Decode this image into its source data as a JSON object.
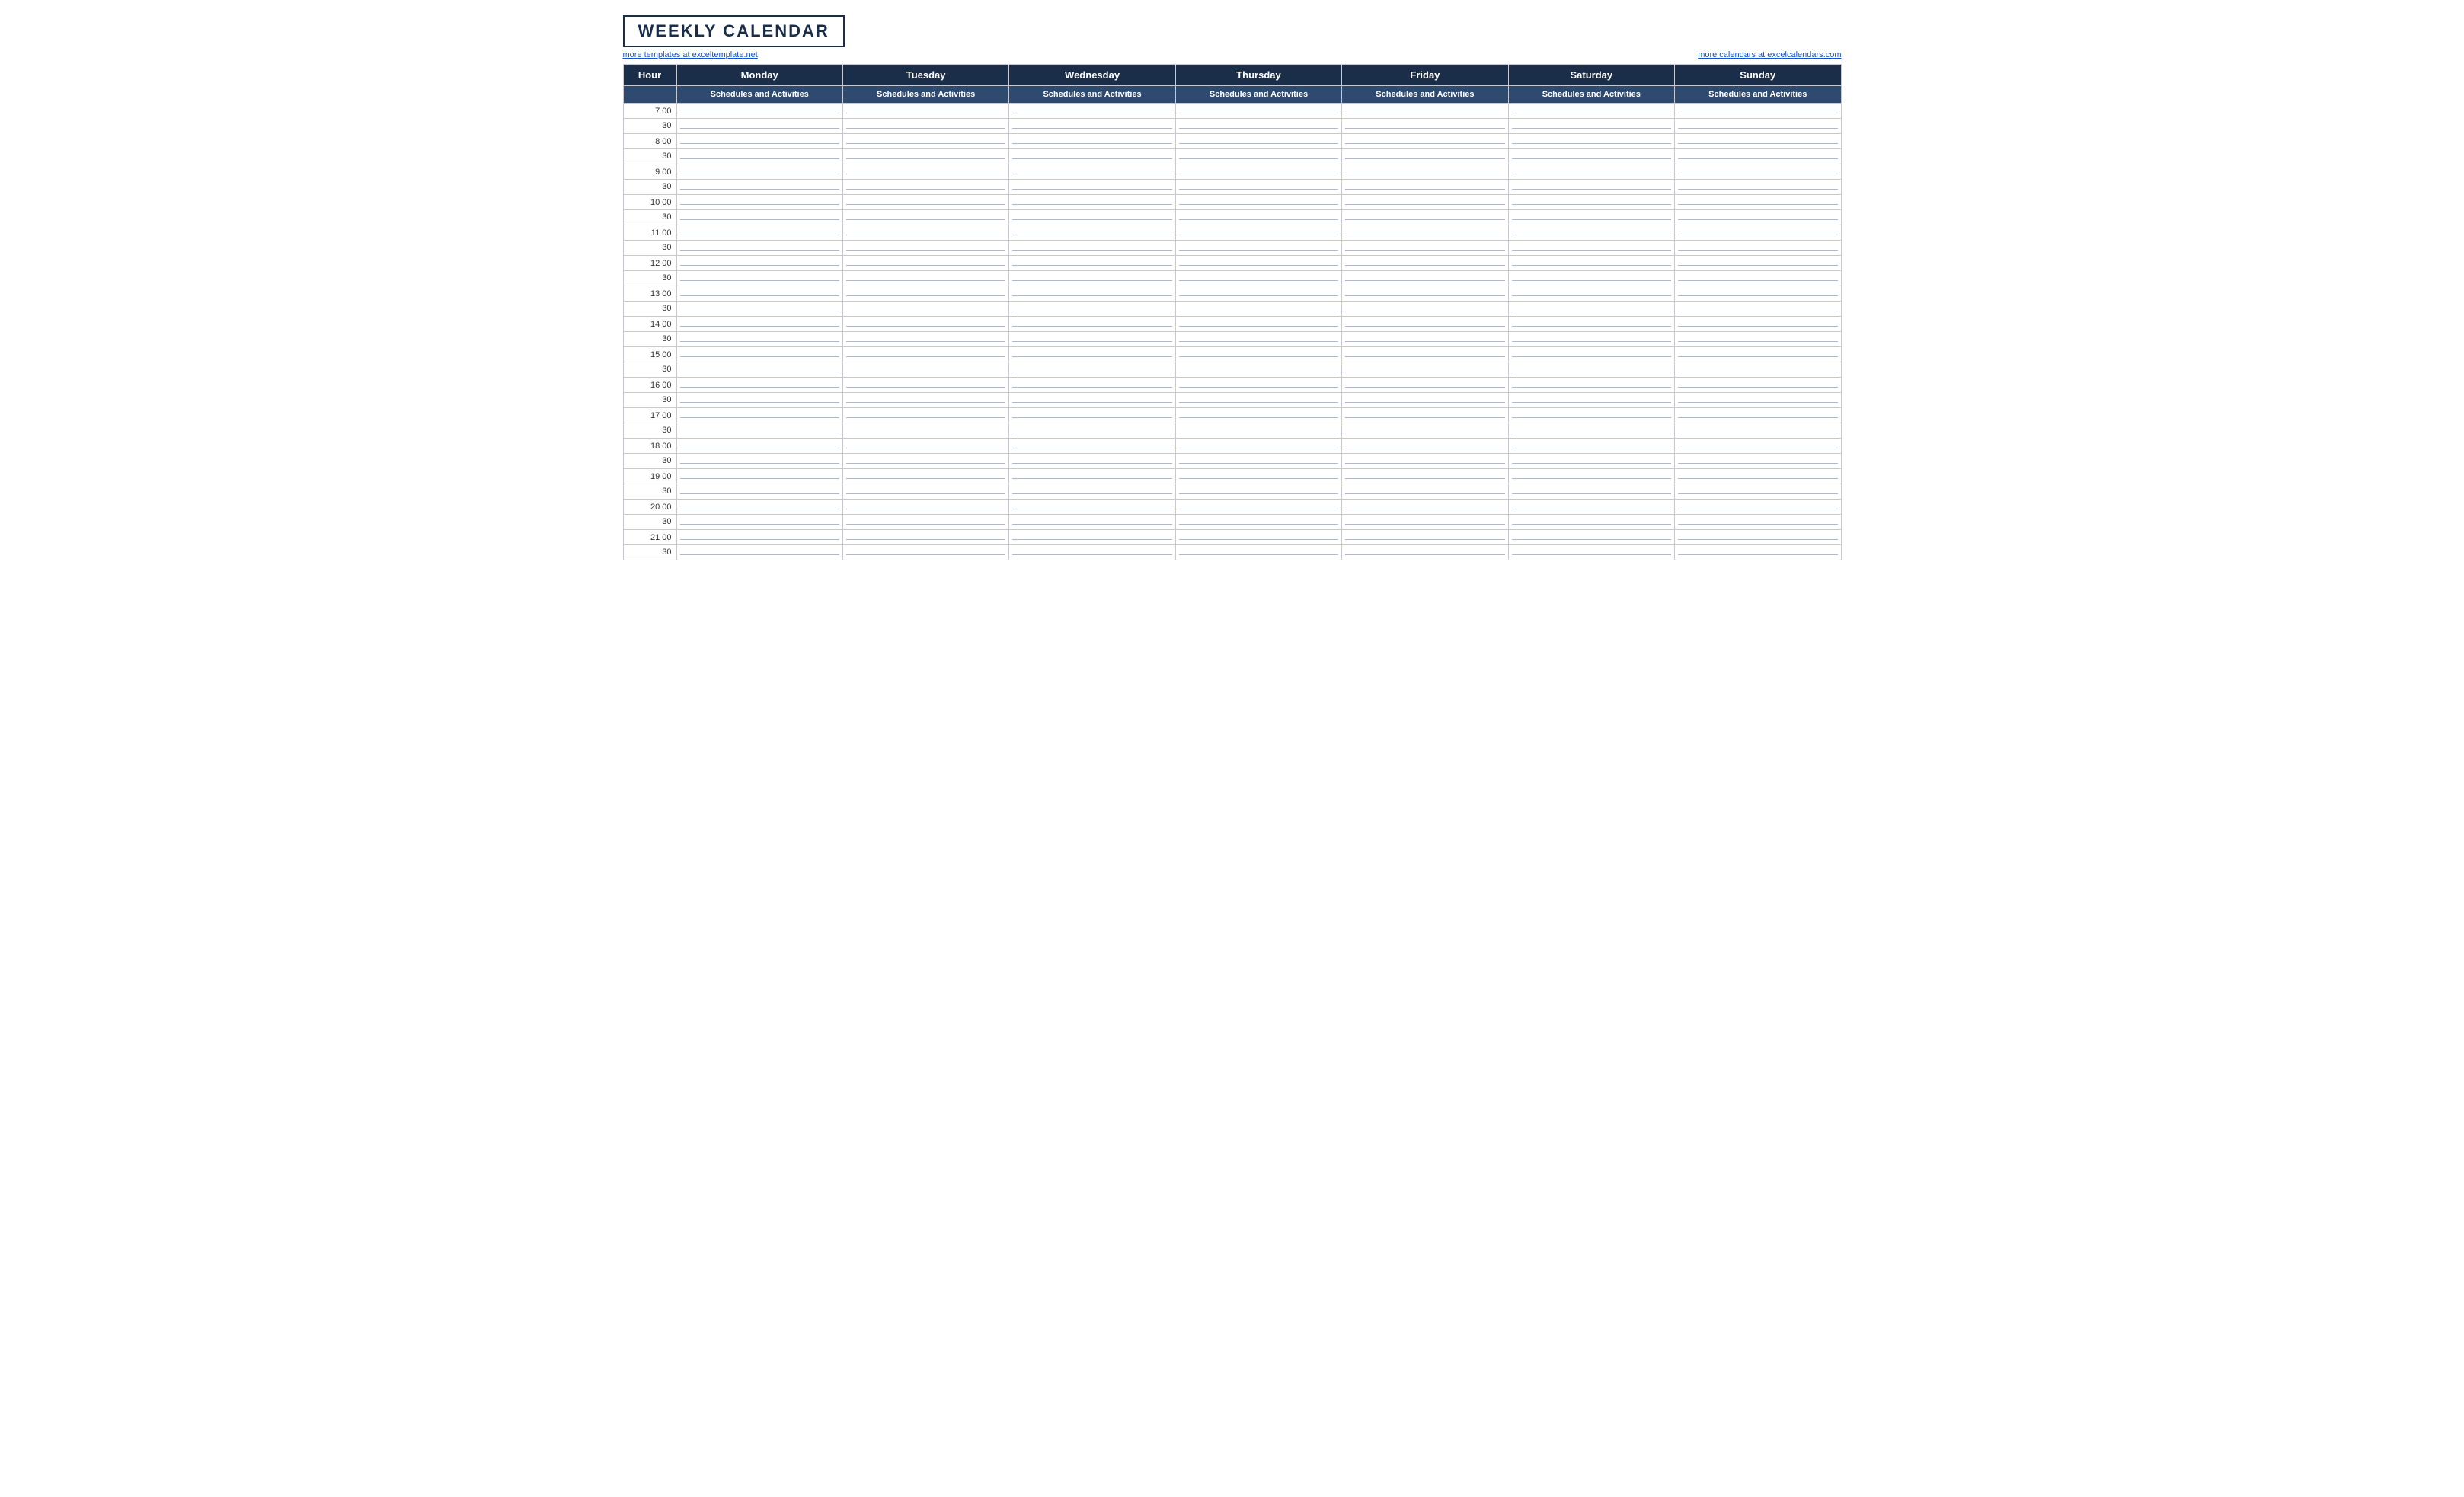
{
  "title": "WEEKLY CALENDAR",
  "link_left": "more templates at exceltemplate.net",
  "link_left_url": "#",
  "link_right": "more calendars at excelcalendars.com",
  "link_right_url": "#",
  "header": {
    "hour_label": "Hour",
    "days": [
      "Monday",
      "Tuesday",
      "Wednesday",
      "Thursday",
      "Friday",
      "Saturday",
      "Sunday"
    ],
    "subheader": "Schedules and Activities"
  },
  "hours": [
    {
      "hour": "7",
      "half": "30"
    },
    {
      "hour": "8",
      "half": "30"
    },
    {
      "hour": "9",
      "half": "30"
    },
    {
      "hour": "10",
      "half": "30"
    },
    {
      "hour": "11",
      "half": "30"
    },
    {
      "hour": "12",
      "half": "30"
    },
    {
      "hour": "13",
      "half": "30"
    },
    {
      "hour": "14",
      "half": "30"
    },
    {
      "hour": "15",
      "half": "30"
    },
    {
      "hour": "16",
      "half": "30"
    },
    {
      "hour": "17",
      "half": "30"
    },
    {
      "hour": "18",
      "half": "30"
    },
    {
      "hour": "19",
      "half": "30"
    },
    {
      "hour": "20",
      "half": "30"
    },
    {
      "hour": "21",
      "half": "30"
    }
  ],
  "colors": {
    "header_bg": "#1a2e4a",
    "subheader_bg": "#2e4a6e",
    "header_text": "#ffffff",
    "border": "#c8c8d0",
    "line": "#b0b8c8"
  }
}
